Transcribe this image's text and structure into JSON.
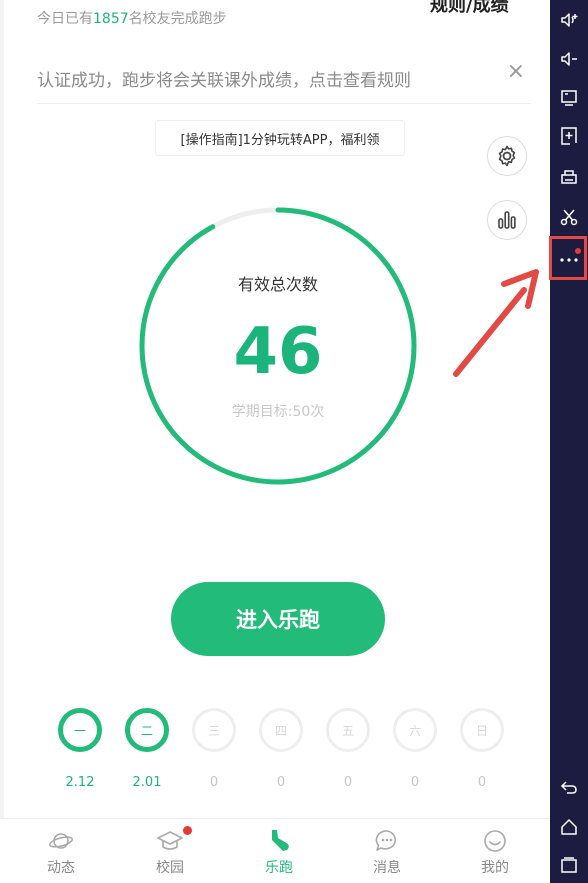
{
  "header": {
    "stats_prefix": "今日已有",
    "stats_count": "1857",
    "stats_suffix": "名校友完成跑步",
    "rules_link": "规则/成绩"
  },
  "notice": {
    "text": "认证成功，跑步将会关联课外成绩，点击查看规则",
    "close": "×"
  },
  "guide": {
    "text": "[操作指南]1分钟玩转APP，福利领"
  },
  "progress": {
    "label": "有效总次数",
    "count": "46",
    "goal_text": "学期目标:50次",
    "ring_fraction": 0.92,
    "color": "#22bb7a",
    "track_color": "#eeeeee"
  },
  "start_button": {
    "label": "进入乐跑"
  },
  "week": [
    {
      "day": "一",
      "value": "2.12",
      "done": true
    },
    {
      "day": "二",
      "value": "2.01",
      "done": true
    },
    {
      "day": "三",
      "value": "0",
      "done": false
    },
    {
      "day": "四",
      "value": "0",
      "done": false
    },
    {
      "day": "五",
      "value": "0",
      "done": false
    },
    {
      "day": "六",
      "value": "0",
      "done": false
    },
    {
      "day": "日",
      "value": "0",
      "done": false
    }
  ],
  "tabs": [
    {
      "label": "动态",
      "icon": "planet-icon"
    },
    {
      "label": "校园",
      "icon": "graduation-cap-icon",
      "badge": true
    },
    {
      "label": "乐跑",
      "icon": "sneaker-icon",
      "active": true
    },
    {
      "label": "消息",
      "icon": "chat-bubble-icon"
    },
    {
      "label": "我的",
      "icon": "smiley-icon"
    }
  ],
  "sidebar": {
    "buttons": [
      "volume-up-icon",
      "volume-down-icon",
      "screen-icon",
      "apk-install-icon",
      "printer-icon",
      "scissors-icon",
      "more-icon",
      "back-icon",
      "home-icon",
      "recent-apps-icon"
    ]
  }
}
